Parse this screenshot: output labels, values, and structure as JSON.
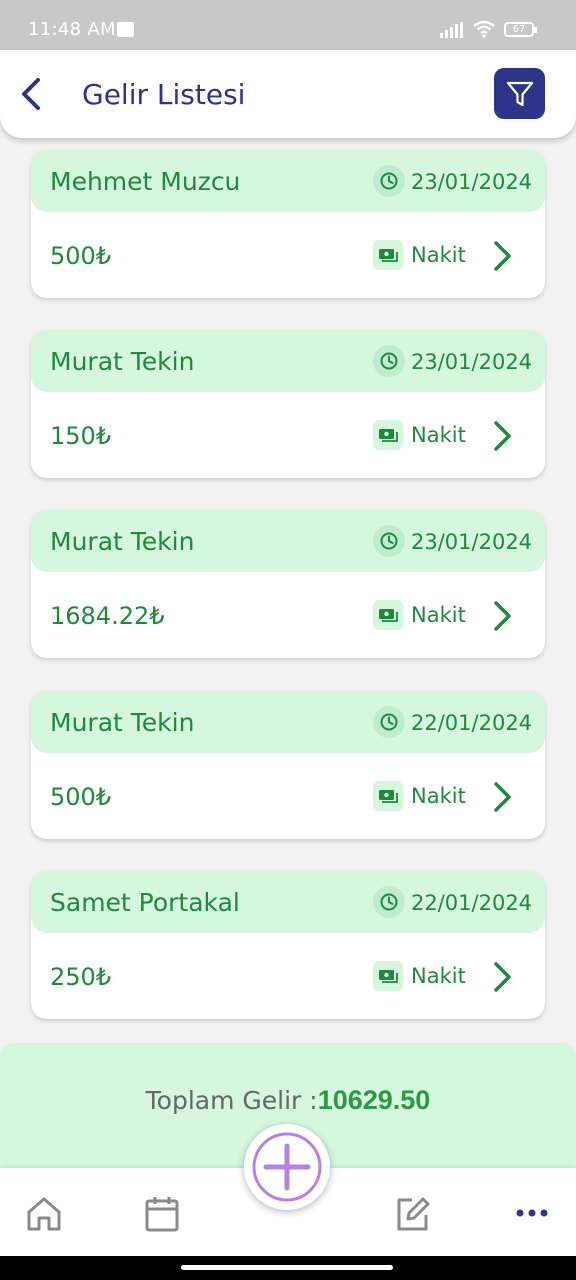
{
  "status_bar": {
    "time": "11:48 AM",
    "battery": "67"
  },
  "header": {
    "title": "Gelir Listesi"
  },
  "colors": {
    "primary": "#2d3589",
    "green": "#1f8a3c",
    "light_green": "#d4f7de",
    "fab_purple": "#b383e6"
  },
  "entries": [
    {
      "name": "Mehmet Muzcu",
      "date": "23/01/2024",
      "amount": "500₺",
      "method": "Nakit"
    },
    {
      "name": "Murat Tekin",
      "date": "23/01/2024",
      "amount": "150₺",
      "method": "Nakit"
    },
    {
      "name": "Murat Tekin",
      "date": "23/01/2024",
      "amount": "1684.22₺",
      "method": "Nakit"
    },
    {
      "name": "Murat Tekin",
      "date": "22/01/2024",
      "amount": "500₺",
      "method": "Nakit"
    },
    {
      "name": "Samet Portakal",
      "date": "22/01/2024",
      "amount": "250₺",
      "method": "Nakit"
    }
  ],
  "total": {
    "label": "Toplam Gelir :",
    "value": "10629.50"
  },
  "bottom_nav": {
    "items": [
      {
        "icon": "home-icon"
      },
      {
        "icon": "calendar-icon"
      },
      {
        "icon": "add-icon"
      },
      {
        "icon": "edit-icon"
      },
      {
        "icon": "more-icon"
      }
    ]
  }
}
